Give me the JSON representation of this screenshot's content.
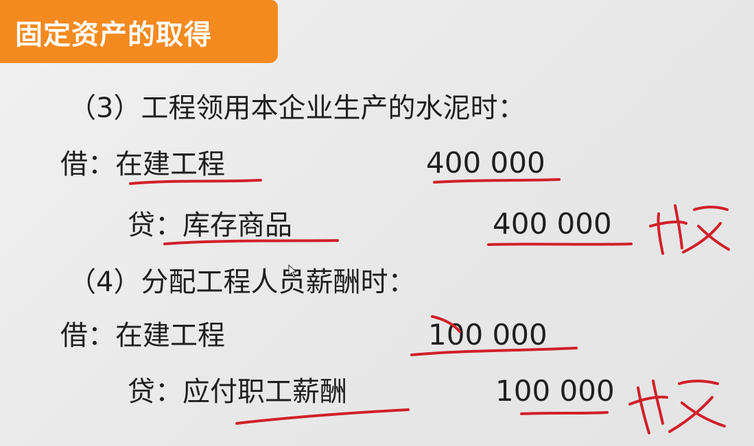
{
  "title": "固定资产的取得",
  "step3": {
    "heading": "（3）工程领用本企业生产的水泥时：",
    "debit_label": "借：",
    "debit_account": "在建工程",
    "debit_amount": "400 000",
    "credit_label": "贷：",
    "credit_account": "库存商品",
    "credit_amount": "400 000"
  },
  "step4": {
    "heading": "（4）分配工程人员薪酬时：",
    "debit_label": "借：",
    "debit_account": "在建工程",
    "debit_amount": "100 000",
    "credit_label": "贷：",
    "credit_account": "应付职工薪酬",
    "credit_amount": "100 000"
  },
  "annotation_color": "#d0202a"
}
